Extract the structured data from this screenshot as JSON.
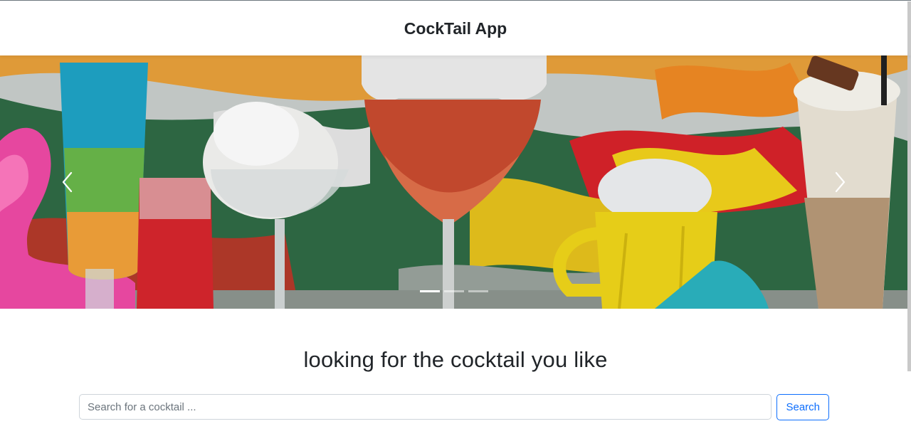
{
  "header": {
    "title": "CockTail App"
  },
  "carousel": {
    "prev_icon": "chevron-left-icon",
    "next_icon": "chevron-right-icon",
    "slides_count": 3,
    "active_slide": 1,
    "image_subject": "colorful cocktails in front of a painted mural"
  },
  "main": {
    "headline": "looking for the cocktail you like"
  },
  "search": {
    "placeholder": "Search for a cocktail ...",
    "value": "",
    "button_label": "Search"
  },
  "colors": {
    "primary": "#0d6efd",
    "text": "#212529",
    "input_border": "#ced4da"
  }
}
